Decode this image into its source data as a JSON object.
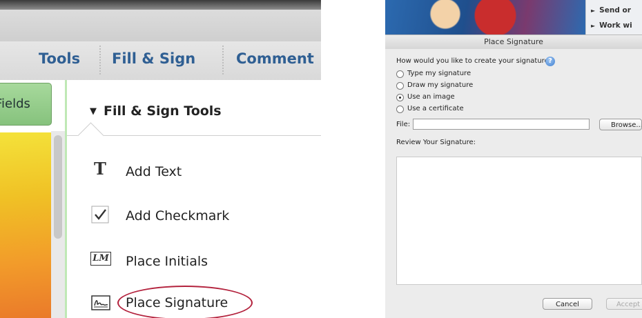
{
  "left": {
    "toolbar": {
      "tools_label": "Tools",
      "fill_sign_label": "Fill & Sign",
      "comment_label": "Comment"
    },
    "fields_button_label": "Fields",
    "panel": {
      "heading_arrow": "▼",
      "heading": "Fill & Sign Tools",
      "items": [
        {
          "label": "Add Text",
          "icon": "text-t-icon"
        },
        {
          "label": "Add Checkmark",
          "icon": "checkmark-icon"
        },
        {
          "label": "Place Initials",
          "icon": "initials-icon"
        },
        {
          "label": "Place Signature",
          "icon": "signature-icon"
        }
      ],
      "initials_glyph": "LM",
      "text_glyph": "T"
    },
    "highlight_color": "#b3223d"
  },
  "right": {
    "side_items": [
      "Send or",
      "Work wi"
    ],
    "side_arrow": "►",
    "dialog": {
      "title": "Place Signature",
      "question": "How would you like to create your signature?",
      "help_glyph": "?",
      "options": [
        {
          "label": "Type my signature",
          "selected": false
        },
        {
          "label": "Draw my signature",
          "selected": false
        },
        {
          "label": "Use an image",
          "selected": true
        },
        {
          "label": "Use a certificate",
          "selected": false
        }
      ],
      "file_label": "File:",
      "file_value": "",
      "browse_label": "Browse...",
      "review_label": "Review Your Signature:",
      "cancel_label": "Cancel",
      "accept_label": "Accept"
    }
  }
}
